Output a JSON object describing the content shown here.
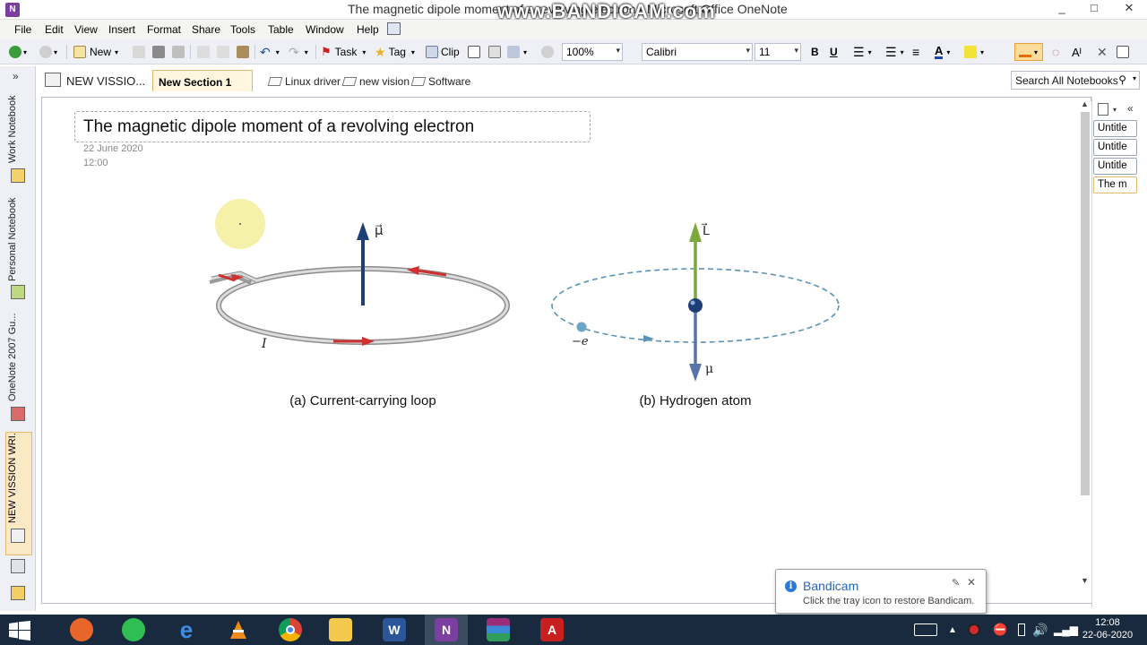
{
  "window": {
    "title": "The magnetic dipole moment of a revolving electron - Microsoft Office OneNote",
    "watermark": "www.BANDICAM.com",
    "controls": [
      "_",
      "□",
      "✕"
    ]
  },
  "menu": [
    "File",
    "Edit",
    "View",
    "Insert",
    "Format",
    "Share",
    "Tools",
    "Table",
    "Window",
    "Help"
  ],
  "toolbar": {
    "new_label": "New",
    "task_label": "Task",
    "tag_label": "Tag",
    "clip_label": "Clip",
    "zoom": "100%",
    "font": "Calibri",
    "font_size": "11",
    "bold": "B",
    "underline": "U"
  },
  "notebook": {
    "name": "NEW VISSIO...",
    "active_section": "New Section 1",
    "links": [
      "Linux driver",
      "new vision",
      "Software"
    ]
  },
  "search": {
    "placeholder": "Search All Notebooks"
  },
  "left_nav": {
    "collapse": "»",
    "notebooks": [
      "Work Notebook",
      "Personal Notebook",
      "OneNote 2007 Gu...",
      "NEW VISSION WRI..."
    ]
  },
  "page": {
    "title": "The magnetic dipole moment of a revolving electron",
    "date": "22 June 2020",
    "time": "12:00"
  },
  "figure": {
    "a_caption": "(a) Current-carrying loop",
    "b_caption": "(b) Hydrogen atom",
    "mu_label": "μ⃗",
    "current_label": "I",
    "L_label": "L⃗",
    "mu_b_label": "μ",
    "electron_label": "−e",
    "colors": {
      "loop": "#c8c8c8",
      "arrow_red": "#d03030",
      "mu_arrow": "#1d3f75",
      "L_arrow": "#7fa83a",
      "mu_b_arrow": "#5876aa",
      "orbit": "#5a94b5",
      "nucleus": "#1d3f75",
      "electron": "#6aa5c8"
    }
  },
  "page_tabs": [
    "Untitle",
    "Untitle",
    "Untitle",
    "The m"
  ],
  "notification": {
    "title": "Bandicam",
    "message": "Click the tray icon to restore Bandicam."
  },
  "taskbar": {
    "apps": [
      "firefox",
      "whatsapp",
      "edge",
      "vlc",
      "chrome",
      "file-explorer",
      "word",
      "onenote",
      "winrar",
      "acrobat"
    ],
    "time": "12:08",
    "date": "22-06-2020"
  }
}
